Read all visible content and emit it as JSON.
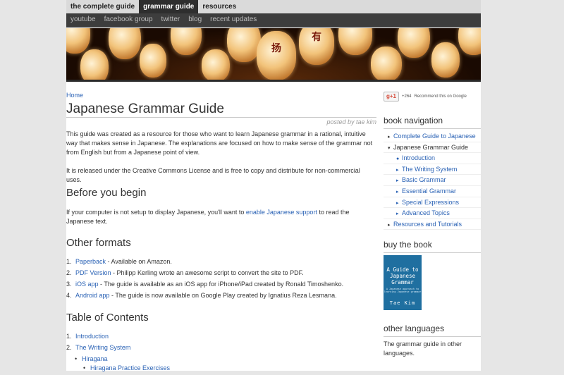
{
  "topnav": [
    "the complete guide",
    "grammar guide",
    "resources"
  ],
  "subnav": [
    "youtube",
    "facebook group",
    "twitter",
    "blog",
    "recent updates"
  ],
  "banner": {
    "kanji": [
      "扬",
      "有"
    ]
  },
  "breadcrumb": "Home",
  "title": "Japanese Grammar Guide",
  "posted": "posted by tae kim",
  "intro1": "This guide was created as a resource for those who want to learn Japanese grammar in a rational, intuitive way that makes sense in Japanese. The explanations are focused on how to make sense of the grammar not from English but from a Japanese point of view.",
  "intro2": "It is released under the Creative Commons License and is free to copy and distribute for non-commercial uses.",
  "before": {
    "heading": "Before you begin",
    "text_before": "If your computer is not setup to display Japanese, you'll want to ",
    "link": "enable Japanese support",
    "text_after": " to read the Japanese text."
  },
  "formats": {
    "heading": "Other formats",
    "items": [
      {
        "num": "1.",
        "link": "Paperback",
        "text": " - Available on Amazon."
      },
      {
        "num": "2.",
        "link": "PDF Version",
        "text": " - Philipp Kerling wrote an awesome script to convert the site to PDF."
      },
      {
        "num": "3.",
        "link": "iOS app",
        "text": " - The guide is available as an iOS app for iPhone/iPad created by Ronald Timoshenko."
      },
      {
        "num": "4.",
        "link": "Android app",
        "text": " - The guide is now available on Google Play created by Ignatius Reza Lesmana."
      }
    ]
  },
  "toc": {
    "heading": "Table of Contents",
    "items": [
      {
        "num": "1.",
        "label": "Introduction"
      },
      {
        "num": "2.",
        "label": "The Writing System"
      },
      {
        "bullet": "•",
        "label": "Hiragana"
      },
      {
        "bullet": "•",
        "label": "Hiragana Practice Exercises"
      }
    ]
  },
  "gplus": {
    "button": "g+1",
    "count": "+264",
    "text": "Recommend this on Google"
  },
  "book_nav": {
    "heading": "book navigation",
    "items": [
      {
        "mark": "▸",
        "label": "Complete Guide to Japanese"
      },
      {
        "mark": "▾",
        "label": "Japanese Grammar Guide"
      },
      {
        "mark": "●",
        "label": "Introduction"
      },
      {
        "mark": "▸",
        "label": "The Writing System"
      },
      {
        "mark": "▸",
        "label": "Basic Grammar"
      },
      {
        "mark": "▸",
        "label": "Essential Grammar"
      },
      {
        "mark": "▸",
        "label": "Special Expressions"
      },
      {
        "mark": "▸",
        "label": "Advanced Topics"
      },
      {
        "mark": "▸",
        "label": "Resources and Tutorials"
      }
    ]
  },
  "buy": {
    "heading": "buy the book",
    "cover_title": "A Guide to Japanese Grammar",
    "cover_subtitle": "A Japanese approach to learning Japanese grammar",
    "cover_author": "Tae Kim"
  },
  "other_lang": {
    "heading": "other languages",
    "text": "The grammar guide in other languages."
  },
  "colors": {
    "link": "#2a62b5",
    "nav_dark": "#2e2e2e",
    "subnav": "#3d3d3d",
    "background": "#e6e6e6"
  }
}
